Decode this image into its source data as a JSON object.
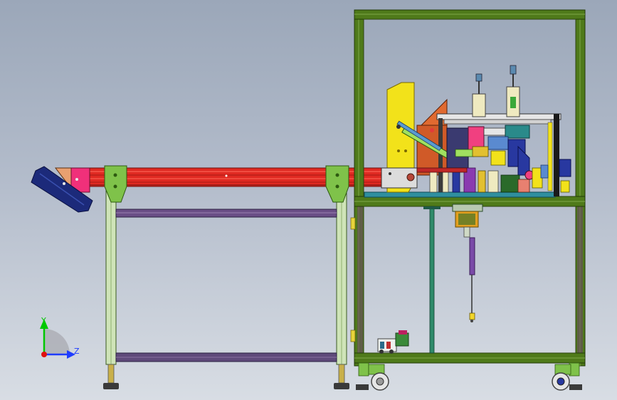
{
  "triad": {
    "y_label": "Y",
    "z_label": "Z",
    "y_color": "#00c800",
    "z_color": "#1e3cff",
    "origin_color": "#e01010"
  },
  "colors": {
    "frame_green": "#4f7a1a",
    "frame_dark": "#2d4410",
    "conveyor_red": "#e02a22",
    "conveyor_dark": "#8a1812",
    "leg_light": "#cfe4b8",
    "bracket_green": "#7fc24a",
    "roller_navy": "#1c2a7a",
    "guard_pink": "#f0307a",
    "guard_peach": "#e8a070",
    "plate_yellow": "#f2e21a",
    "table_top": "#7b8a9a",
    "crossbar_purple": "#6a4e86",
    "teal_base": "#2f8f9f"
  }
}
